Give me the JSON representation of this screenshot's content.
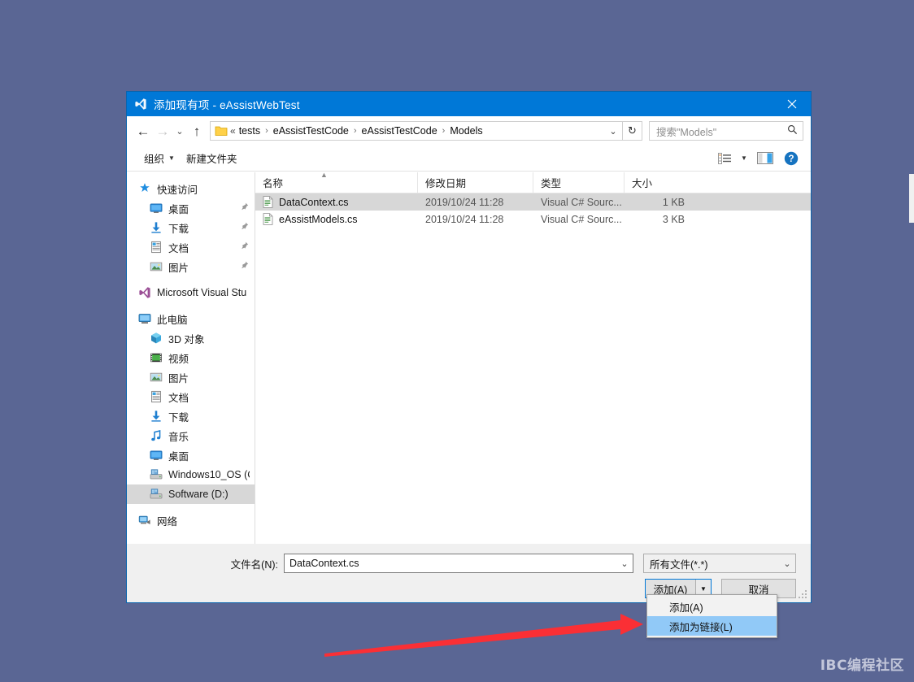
{
  "window": {
    "title": "添加现有项 - eAssistWebTest",
    "title_icon": "visual-studio-icon",
    "close_label": "✕",
    "accent_color": "#0078d7",
    "desktop_background": "#5a6694"
  },
  "nav": {
    "back_icon": "←",
    "forward_icon": "→",
    "recent_icon": "⌄",
    "up_icon": "↑",
    "refresh_icon": "↻",
    "dropdown_icon": "⌄",
    "breadcrumb_prefix": "«",
    "breadcrumbs": [
      {
        "label": "tests"
      },
      {
        "label": "eAssistTestCode"
      },
      {
        "label": "eAssistTestCode"
      },
      {
        "label": "Models"
      }
    ],
    "separator": "›"
  },
  "search": {
    "placeholder": "搜索\"Models\"",
    "icon": "search-icon"
  },
  "commandbar": {
    "organize_label": "组织",
    "organize_caret": "▼",
    "new_folder_label": "新建文件夹",
    "view_icon": "list-view-icon",
    "view_caret": "▼",
    "pane_icon": "preview-pane-icon",
    "help_icon": "help-icon",
    "help_glyph": "?"
  },
  "sidebar": {
    "groups": [
      {
        "items": [
          {
            "label": "快速访问",
            "icon": "quick-access-star-icon",
            "level": 0,
            "pinned": false,
            "selected": false
          },
          {
            "label": "桌面",
            "icon": "desktop-icon",
            "level": 1,
            "pinned": true,
            "selected": false
          },
          {
            "label": "下载",
            "icon": "downloads-icon",
            "level": 1,
            "pinned": true,
            "selected": false
          },
          {
            "label": "文档",
            "icon": "documents-icon",
            "level": 1,
            "pinned": true,
            "selected": false
          },
          {
            "label": "图片",
            "icon": "pictures-icon",
            "level": 1,
            "pinned": true,
            "selected": false
          }
        ]
      },
      {
        "items": [
          {
            "label": "Microsoft Visual Stu",
            "icon": "visual-studio-icon",
            "level": 0,
            "pinned": false,
            "selected": false
          }
        ]
      },
      {
        "items": [
          {
            "label": "此电脑",
            "icon": "this-pc-icon",
            "level": 0,
            "pinned": false,
            "selected": false
          },
          {
            "label": "3D 对象",
            "icon": "3d-objects-icon",
            "level": 1,
            "pinned": false,
            "selected": false
          },
          {
            "label": "视频",
            "icon": "videos-icon",
            "level": 1,
            "pinned": false,
            "selected": false
          },
          {
            "label": "图片",
            "icon": "pictures-icon",
            "level": 1,
            "pinned": false,
            "selected": false
          },
          {
            "label": "文档",
            "icon": "documents-icon",
            "level": 1,
            "pinned": false,
            "selected": false
          },
          {
            "label": "下载",
            "icon": "downloads-icon",
            "level": 1,
            "pinned": false,
            "selected": false
          },
          {
            "label": "音乐",
            "icon": "music-icon",
            "level": 1,
            "pinned": false,
            "selected": false
          },
          {
            "label": "桌面",
            "icon": "desktop-icon",
            "level": 1,
            "pinned": false,
            "selected": false
          },
          {
            "label": "Windows10_OS (C",
            "icon": "drive-icon",
            "level": 1,
            "pinned": false,
            "selected": false
          },
          {
            "label": "Software (D:)",
            "icon": "drive-icon",
            "level": 1,
            "pinned": false,
            "selected": true
          }
        ]
      },
      {
        "items": [
          {
            "label": "网络",
            "icon": "network-icon",
            "level": 0,
            "pinned": false,
            "selected": false
          }
        ]
      }
    ],
    "pin_glyph": "📌"
  },
  "filelist": {
    "columns": [
      {
        "key": "name",
        "label": "名称",
        "sorted": true,
        "sort_arrow": "▲"
      },
      {
        "key": "date",
        "label": "修改日期",
        "sorted": false
      },
      {
        "key": "type",
        "label": "类型",
        "sorted": false
      },
      {
        "key": "size",
        "label": "大小",
        "sorted": false
      }
    ],
    "rows": [
      {
        "icon": "cs-file-icon",
        "name": "DataContext.cs",
        "date": "2019/10/24 11:28",
        "type": "Visual C# Sourc...",
        "size": "1 KB",
        "selected": true
      },
      {
        "icon": "cs-file-icon",
        "name": "eAssistModels.cs",
        "date": "2019/10/24 11:28",
        "type": "Visual C# Sourc...",
        "size": "3 KB",
        "selected": false
      }
    ]
  },
  "footer": {
    "filename_label": "文件名(N):",
    "filename_value": "DataContext.cs",
    "filename_caret": "⌄",
    "filter_value": "所有文件(*.*)",
    "filter_caret": "⌄",
    "add_button_label": "添加(A)",
    "add_button_caret": "▼",
    "cancel_button_label": "取消"
  },
  "dropdown_menu": {
    "items": [
      {
        "label": "添加(A)",
        "highlighted": false
      },
      {
        "label": "添加为链接(L)",
        "highlighted": true
      }
    ]
  },
  "annotation": {
    "arrow_color": "#fa2f35",
    "arrow_direction": "right"
  },
  "watermark": {
    "text": "IBC编程社区",
    "color": "#c3c7da"
  }
}
